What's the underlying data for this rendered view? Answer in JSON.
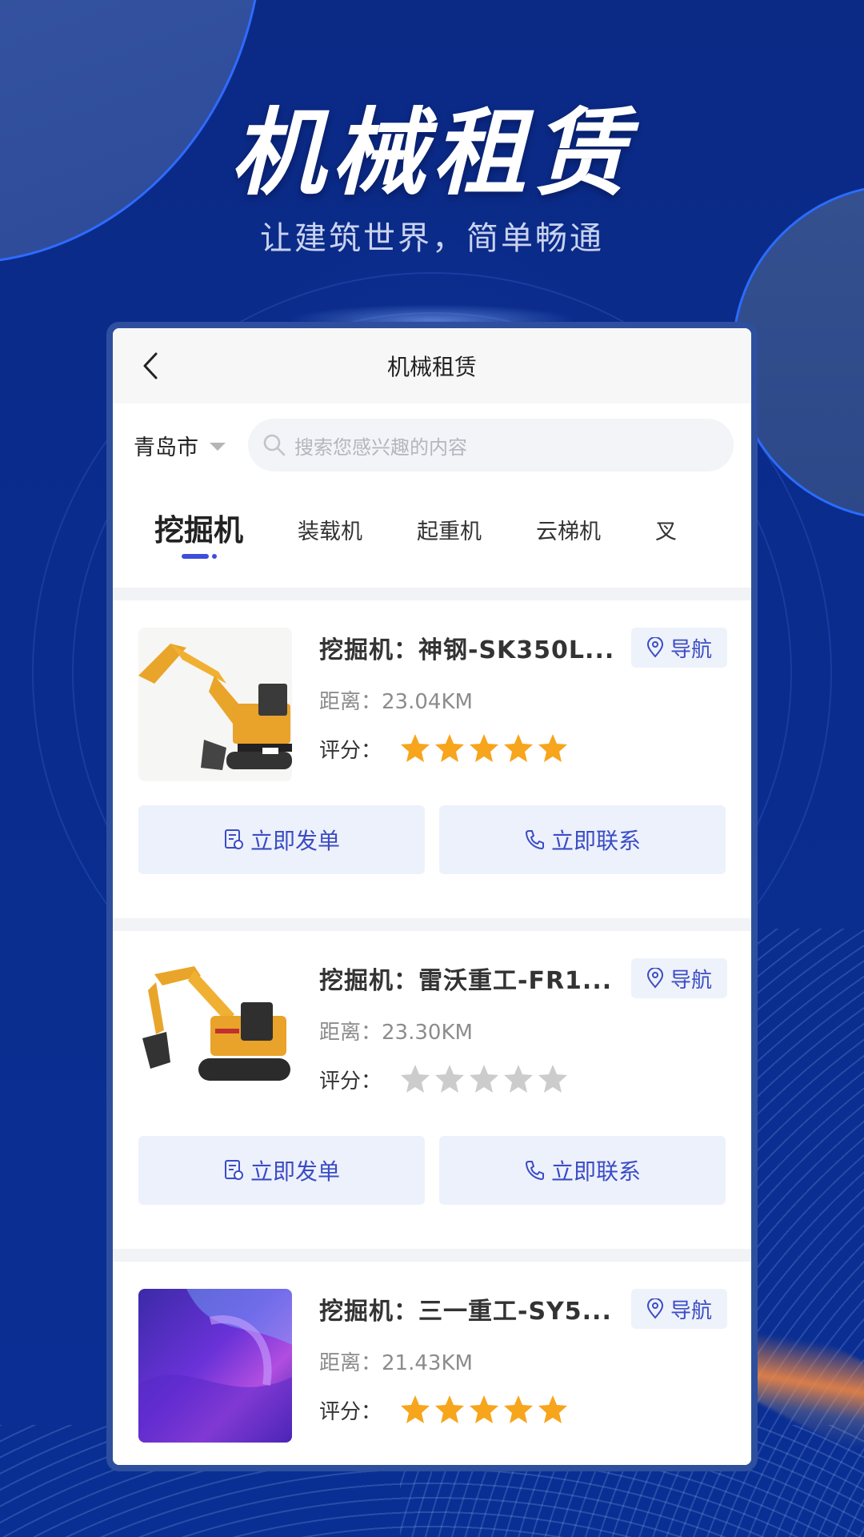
{
  "hero": {
    "title": "机械租赁",
    "subtitle": "让建筑世界，简单畅通"
  },
  "navbar": {
    "title": "机械租赁",
    "back_icon": "chevron-left-icon"
  },
  "search": {
    "city": "青岛市",
    "placeholder": "搜索您感兴趣的内容"
  },
  "tabs": [
    {
      "label": "挖掘机",
      "active": true
    },
    {
      "label": "装载机",
      "active": false
    },
    {
      "label": "起重机",
      "active": false
    },
    {
      "label": "云梯机",
      "active": false
    },
    {
      "label": "叉",
      "active": false
    }
  ],
  "labels": {
    "distance": "距离：",
    "rating": "评分：",
    "navigate": "导航",
    "order": "立即发单",
    "contact": "立即联系"
  },
  "items": [
    {
      "name": "挖掘机：神钢-SK350L...",
      "distance": "23.04KM",
      "stars": 5,
      "image": "excavator-small"
    },
    {
      "name": "挖掘机：雷沃重工-FR1...",
      "distance": "23.30KM",
      "stars": 0,
      "image": "excavator-large"
    },
    {
      "name": "挖掘机：三一重工-SY5...",
      "distance": "21.43KM",
      "stars": 5,
      "image": "abstract-purple"
    }
  ],
  "colors": {
    "accent": "#3b4cc4",
    "star_active": "#f7a51c",
    "star_inactive": "#cccccc",
    "background": "#0a2a8a"
  }
}
